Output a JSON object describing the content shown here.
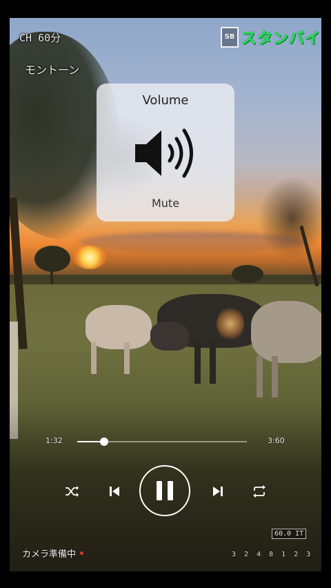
{
  "overlay": {
    "camera_counter": "CH 60分",
    "mode_label": "モントーン",
    "brand": {
      "mark": "SB",
      "text": "スタンバイ",
      "color": "#2bd95a"
    },
    "camera_status": "カメラ準備中",
    "fps_badge": "60.0 IT",
    "date_stamp": "3 2 4 8 1 2 3"
  },
  "volume_panel": {
    "title": "Volume",
    "icon": "speaker-volume-icon",
    "status": "Mute"
  },
  "player": {
    "current_time": "1:32",
    "total_time": "3:60",
    "progress": 0.16,
    "controls": {
      "shuffle": "shuffle-icon",
      "previous": "skip-previous-icon",
      "pause": "pause-icon",
      "next": "skip-next-icon",
      "repeat": "repeat-icon"
    }
  }
}
